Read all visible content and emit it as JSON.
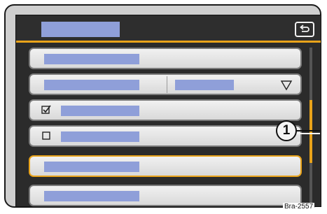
{
  "header": {
    "back_icon": "back-return-icon"
  },
  "list": {
    "checkbox_checked_icon": "checkbox-checked-icon",
    "checkbox_unchecked_icon": "checkbox-unchecked-icon",
    "dropdown_icon": "dropdown-triangle-icon",
    "rows": [
      {
        "type": "item",
        "checked": null,
        "selected": false
      },
      {
        "type": "dropdown",
        "checked": null,
        "selected": false
      },
      {
        "type": "checkbox",
        "checked": true,
        "selected": false
      },
      {
        "type": "checkbox",
        "checked": false,
        "selected": false
      },
      {
        "type": "item",
        "checked": null,
        "selected": true
      },
      {
        "type": "item",
        "checked": null,
        "selected": false
      }
    ]
  },
  "scrollbar": {
    "position_fraction": 0.33,
    "visible_fraction": 0.4
  },
  "callout": {
    "label": "1"
  },
  "watermark": {
    "text": "Bra-2557"
  },
  "colors": {
    "accent": "#e9a31a",
    "placeholder_bar": "#8f9fd9",
    "screen_background": "#2b2b2b"
  }
}
